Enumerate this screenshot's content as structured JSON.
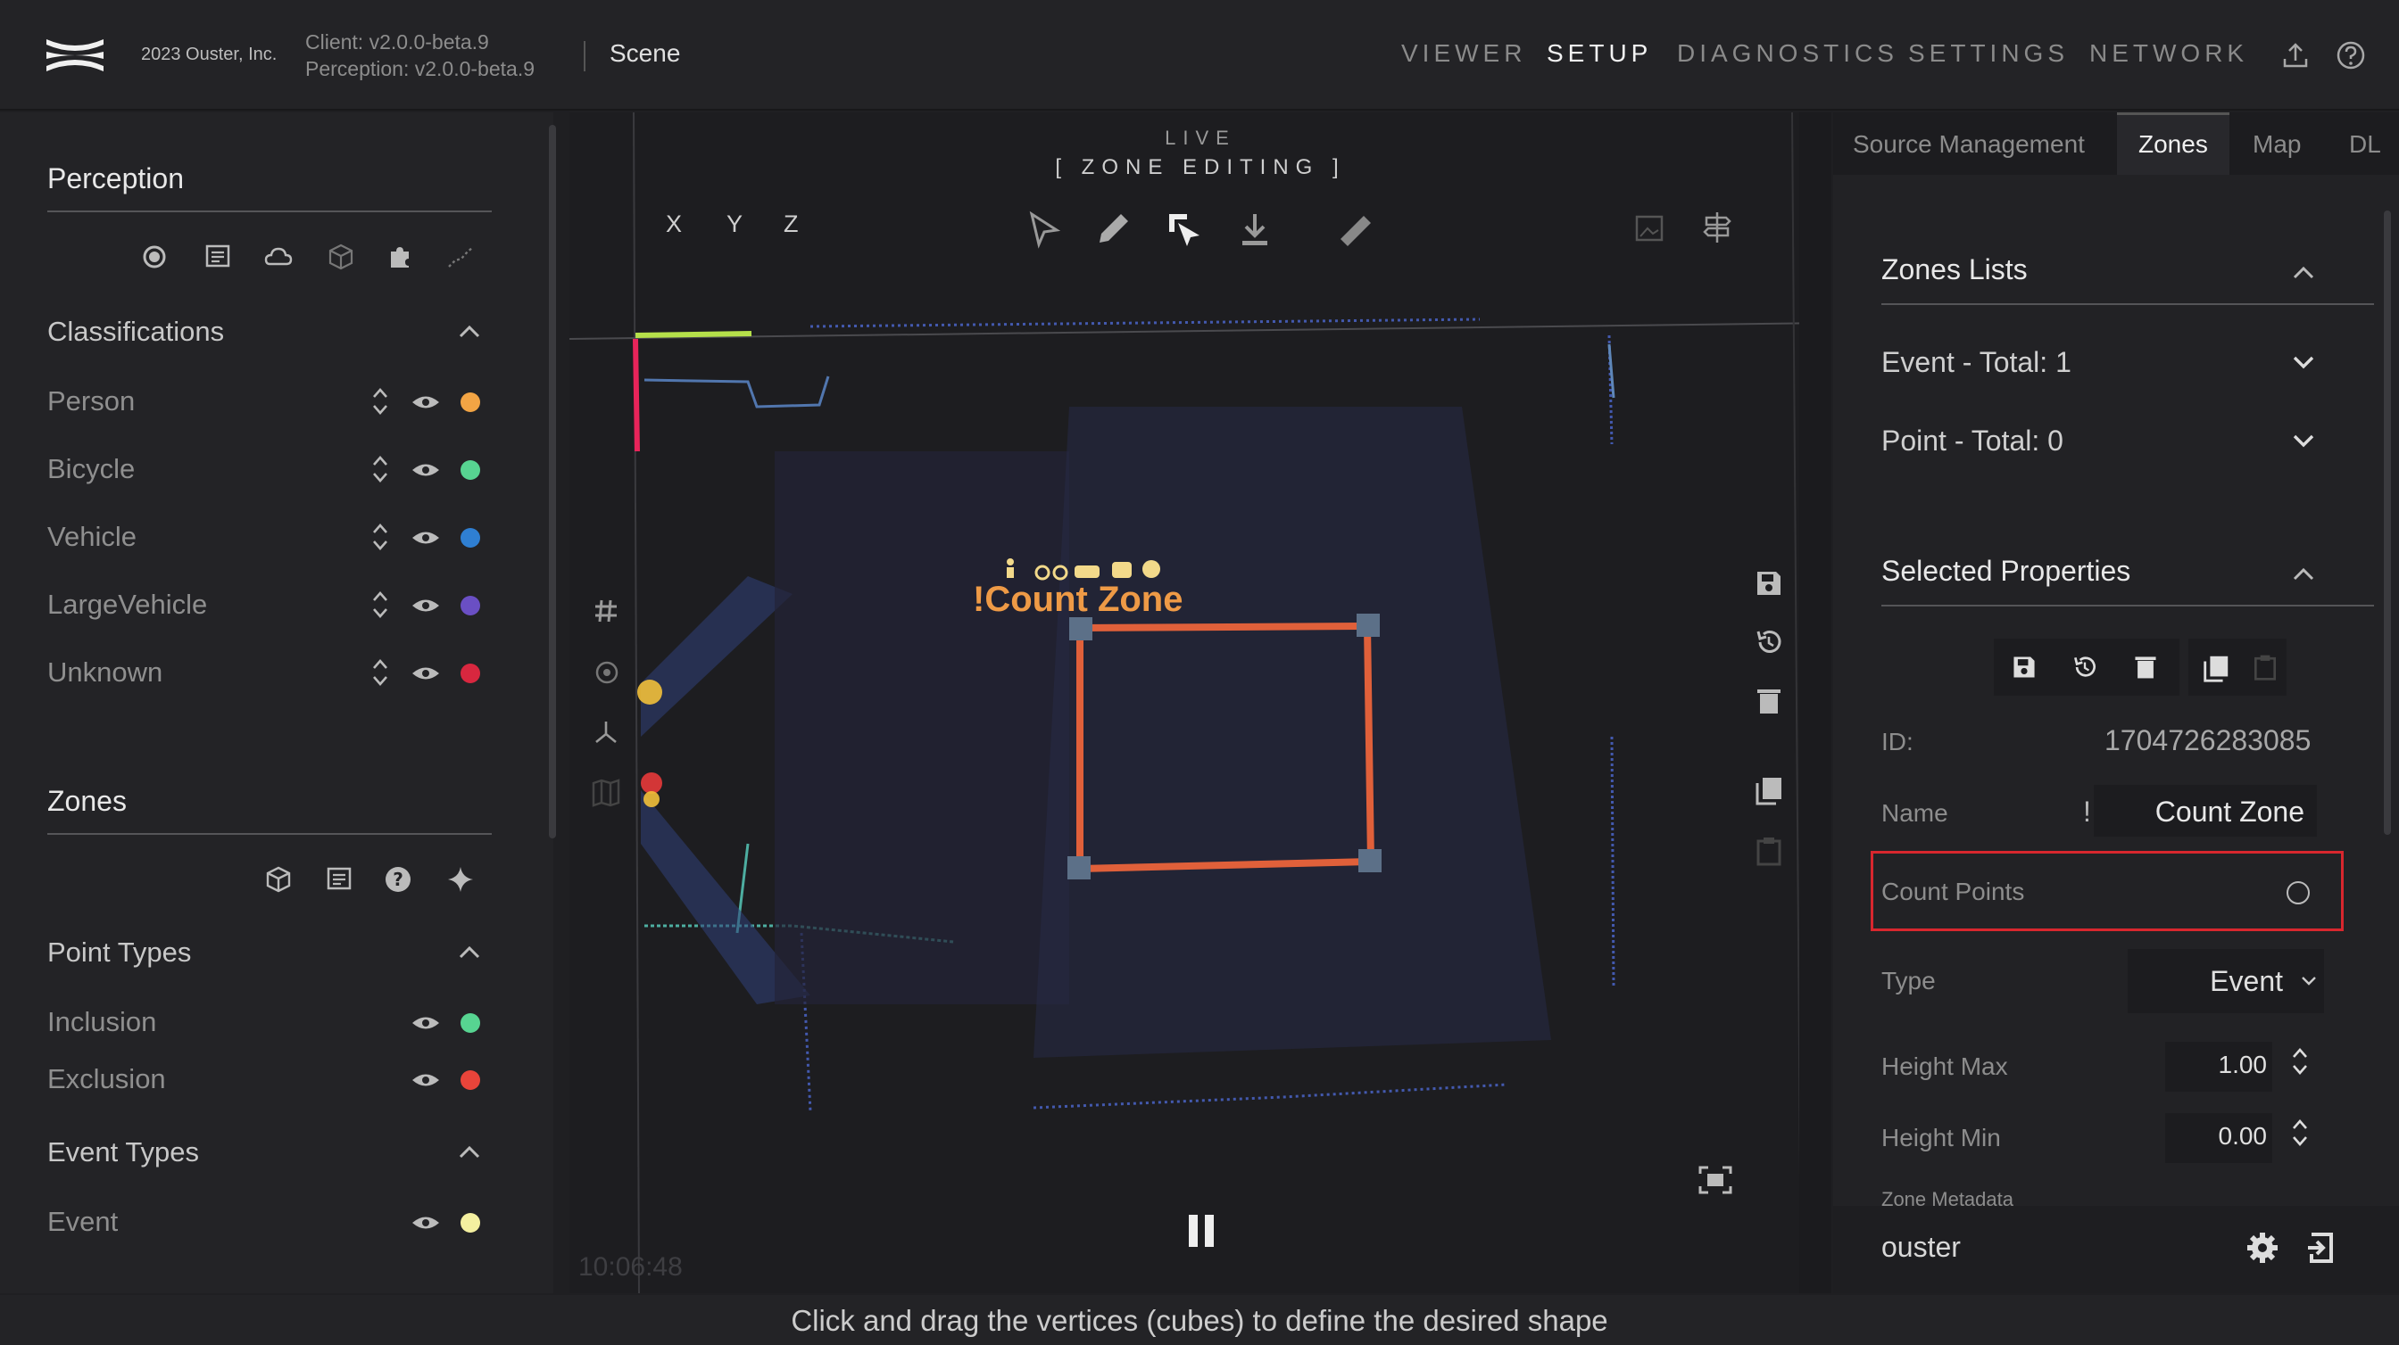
{
  "header": {
    "copyright": "2023 Ouster, Inc.",
    "client_version": "Client: v2.0.0-beta.9",
    "perception_version": "Perception: v2.0.0-beta.9",
    "scene": "Scene",
    "nav": [
      "VIEWER",
      "SETUP",
      "DIAGNOSTICS",
      "SETTINGS",
      "NETWORK"
    ],
    "active_nav": "SETUP",
    "icons": [
      "upload-icon",
      "help-icon"
    ]
  },
  "left": {
    "perception_title": "Perception",
    "classifications_title": "Classifications",
    "classes": [
      {
        "label": "Person",
        "color": "#f2a444"
      },
      {
        "label": "Bicycle",
        "color": "#57d491"
      },
      {
        "label": "Vehicle",
        "color": "#2f7fd2"
      },
      {
        "label": "LargeVehicle",
        "color": "#6a4fc4"
      },
      {
        "label": "Unknown",
        "color": "#d8273f"
      }
    ],
    "zones_title": "Zones",
    "point_types_title": "Point Types",
    "point_types": [
      {
        "label": "Inclusion",
        "color": "#57d491"
      },
      {
        "label": "Exclusion",
        "color": "#e8443a"
      }
    ],
    "event_types_title": "Event Types",
    "event_types": [
      {
        "label": "Event",
        "color": "#f4f0a0"
      }
    ]
  },
  "viewport": {
    "live": "LIVE",
    "mode": "[ ZONE EDITING ]",
    "axes": [
      "X",
      "Y",
      "Z"
    ],
    "zone_label": "!Count Zone",
    "timestamp": "10:06:48",
    "zone_color": "#e0603a"
  },
  "right": {
    "tabs": [
      "Source Management",
      "Zones",
      "Map",
      "DL"
    ],
    "active_tab": "Zones",
    "zones_lists_title": "Zones Lists",
    "event_total": "Event - Total: 1",
    "point_total": "Point - Total: 0",
    "selected_title": "Selected Properties",
    "id_label": "ID:",
    "id_value": "1704726283085",
    "name_label": "Name",
    "name_prefix": "!",
    "name_value": "Count Zone",
    "count_points_label": "Count Points",
    "type_label": "Type",
    "type_value": "Event",
    "height_max_label": "Height Max",
    "height_max_value": "1.00",
    "height_min_label": "Height Min",
    "height_min_value": "0.00",
    "zone_metadata_label": "Zone Metadata",
    "user": "ouster"
  },
  "status": {
    "hint": "Click and drag the vertices (cubes) to define the desired shape"
  }
}
